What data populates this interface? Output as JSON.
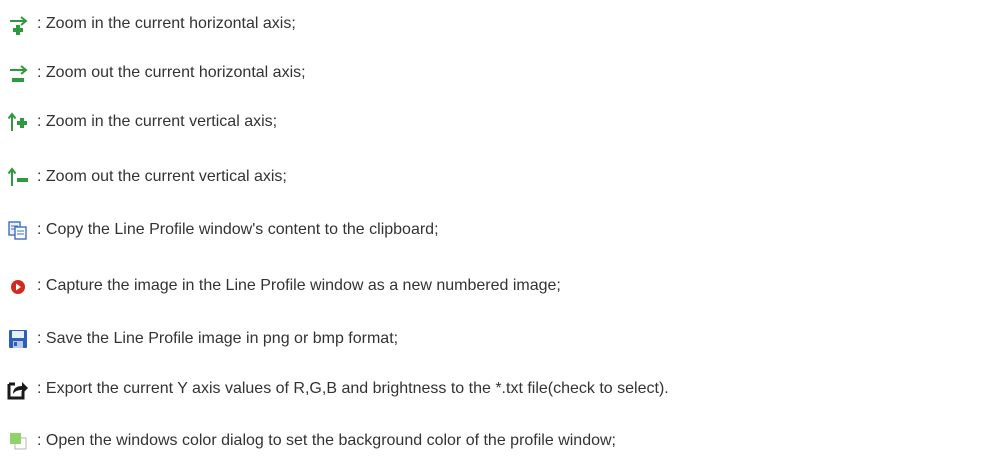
{
  "items": [
    {
      "icon": "zoom-in-horizontal-icon",
      "text": ": Zoom in the current horizontal axis;"
    },
    {
      "icon": "zoom-out-horizontal-icon",
      "text": ": Zoom out the current horizontal axis;"
    },
    {
      "icon": "zoom-in-vertical-icon",
      "text": ": Zoom in the current vertical axis;"
    },
    {
      "icon": "zoom-out-vertical-icon",
      "text": ": Zoom out the current vertical axis;"
    },
    {
      "icon": "copy-icon",
      "text": ": Copy the Line Profile window's content to the clipboard;"
    },
    {
      "icon": "capture-icon",
      "text": ": Capture the image in the Line Profile window as a new numbered image;"
    },
    {
      "icon": "save-icon",
      "text": ": Save the Line Profile image in png or bmp format;"
    },
    {
      "icon": "export-icon",
      "text": ": Export the current Y axis values of R,G,B and brightness to the *.txt file(check to select)."
    },
    {
      "icon": "background-color-icon",
      "text": ": Open the windows color dialog to set the background color of the profile window;"
    }
  ],
  "colors": {
    "icon_green": "#2e9a3e",
    "text": "#333333"
  }
}
